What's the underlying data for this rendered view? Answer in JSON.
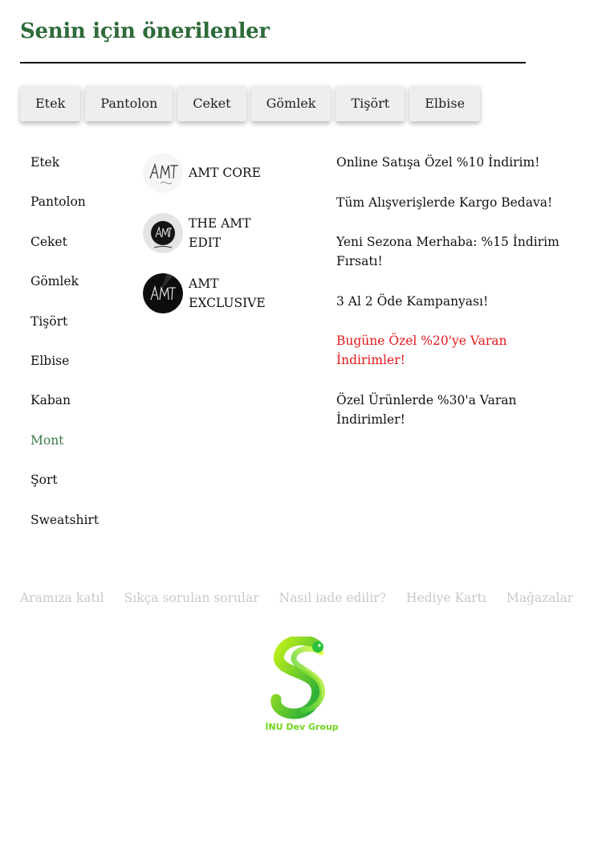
{
  "header": {
    "title": "Senin için önerilenler"
  },
  "chips": [
    "Etek",
    "Pantolon",
    "Ceket",
    "Gömlek",
    "Tişört",
    "Elbise"
  ],
  "categories": {
    "items": [
      "Etek",
      "Pantolon",
      "Ceket",
      "Gömlek",
      "Tişört",
      "Elbise",
      "Kaban",
      "Mont",
      "Şort",
      "Sweatshirt"
    ],
    "active": "Mont",
    "active_color": "#3a7a45"
  },
  "brands": [
    {
      "name": "AMT CORE",
      "logo_text": "AMT"
    },
    {
      "name": "THE AMT EDIT",
      "logo_text": "AMT"
    },
    {
      "name": "AMT EXCLUSIVE",
      "logo_text": "AMT"
    }
  ],
  "promos": [
    {
      "text": "Online Satışa Özel %10 İndirim!",
      "highlight": false
    },
    {
      "text": "Tüm Alışverişlerde Kargo Bedava!",
      "highlight": false
    },
    {
      "text": "Yeni Sezona Merhaba: %15 İndirim Fırsatı!",
      "highlight": false
    },
    {
      "text": "3 Al 2 Öde Kampanyası!",
      "highlight": false
    },
    {
      "text": "Bugüne Özel %20'ye Varan İndirimler!",
      "highlight": true
    },
    {
      "text": "Özel Ürünlerde %30'a Varan İndirimler!",
      "highlight": false
    }
  ],
  "footer": {
    "links": [
      "Aramıza katıl",
      "Sıkça sorulan sorular",
      "Nasıl iade edilir?",
      "Hediye Kartı",
      "Mağazalar"
    ],
    "logo_caption": "İNU Dev Group"
  },
  "colors": {
    "accent": "#2e6b3a",
    "promo_highlight": "#e5191d",
    "footer_link": "#c8c8c8",
    "logo_green": "#6fd61e"
  }
}
